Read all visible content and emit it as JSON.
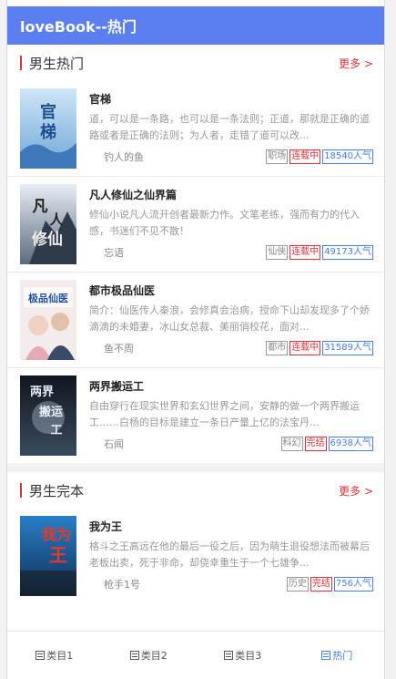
{
  "header": {
    "title": "loveBook--热门"
  },
  "sections": [
    {
      "title": "男生热门",
      "more_label": "更多 >",
      "books": [
        {
          "title": "官梯",
          "desc": "道，可以是一条路，也可以是一条法则；正道，那就是正确的道路或者是正确的法则；为人者，走错了道可以改...",
          "author": "钓人的鱼",
          "tags": [
            "职场",
            "连载中",
            "18540人气"
          ],
          "cover_text": "官梯"
        },
        {
          "title": "凡人修仙之仙界篇",
          "desc": "修仙小说凡人流开创者最新力作。文笔老练，强而有力的代入感，书迷们不见不散！",
          "author": "忘语",
          "tags": [
            "仙侠",
            "连载中",
            "49173人气"
          ],
          "cover_text": "凡人修仙"
        },
        {
          "title": "都市极品仙医",
          "desc": "简介：仙医传人秦浪，会修真会治病，授命下山却发现多了个娇滴滴的未婚妻，冰山女总裁、美丽俏校花，面对...",
          "author": "鱼不周",
          "tags": [
            "都市",
            "连载中",
            "31589人气"
          ],
          "cover_text": "都市极品仙医"
        },
        {
          "title": "两界搬运工",
          "desc": "自由穿行在现实世界和玄幻世界之间，安静的做一个两界搬运工……白杨的目标是建立一条日产量上亿的法宝丹...",
          "author": "石闻",
          "tags": [
            "科幻",
            "完结",
            "6938人气"
          ],
          "cover_text": "两界搬运工"
        }
      ]
    },
    {
      "title": "男生完本",
      "more_label": "更多 >",
      "books": [
        {
          "title": "我为王",
          "desc": "格斗之王高远在他的最后一役之后，因为萌生退役想法而被幕后老板出卖，死于非命，却侥幸重生于一个七雄争...",
          "author": "枪手1号",
          "tags": [
            "历史",
            "完结",
            "756人气"
          ],
          "cover_text": "我为王"
        }
      ]
    }
  ],
  "nav": [
    {
      "label": "类目1",
      "active": false
    },
    {
      "label": "类目2",
      "active": false
    },
    {
      "label": "类目3",
      "active": false
    },
    {
      "label": "热门",
      "active": true
    }
  ],
  "colors": {
    "header": "#5b7ff0",
    "accent_red": "#d9323a",
    "accent_blue": "#4a7fe0"
  }
}
